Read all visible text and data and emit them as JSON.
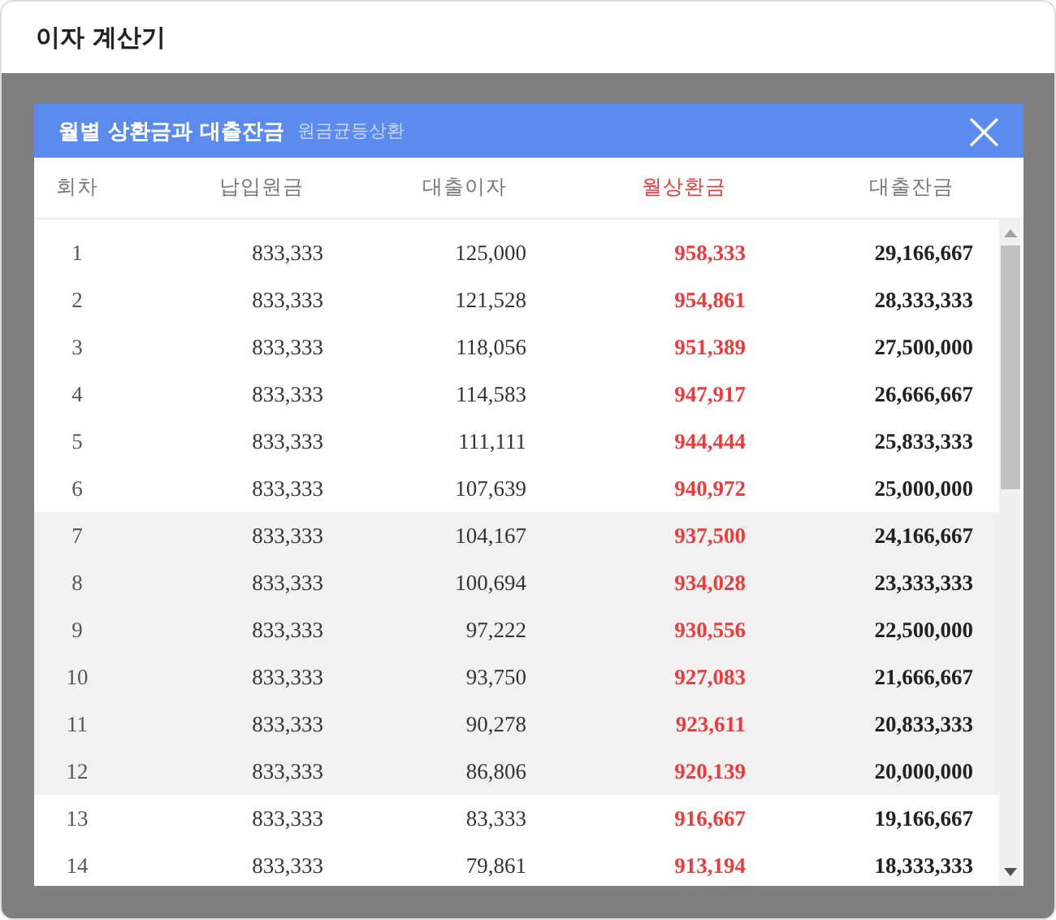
{
  "page_title": "이자 계산기",
  "modal": {
    "title": "월별 상환금과 대출잔금",
    "subtitle": "원금균등상환",
    "close": "×"
  },
  "table": {
    "columns": [
      "회차",
      "납입원금",
      "대출이자",
      "월상환금",
      "대출잔금"
    ],
    "rows": [
      {
        "cells": [
          "1",
          "833,333",
          "125,000",
          "958,333",
          "29,166,667"
        ],
        "shaded": false
      },
      {
        "cells": [
          "2",
          "833,333",
          "121,528",
          "954,861",
          "28,333,333"
        ],
        "shaded": false
      },
      {
        "cells": [
          "3",
          "833,333",
          "118,056",
          "951,389",
          "27,500,000"
        ],
        "shaded": false
      },
      {
        "cells": [
          "4",
          "833,333",
          "114,583",
          "947,917",
          "26,666,667"
        ],
        "shaded": false
      },
      {
        "cells": [
          "5",
          "833,333",
          "111,111",
          "944,444",
          "25,833,333"
        ],
        "shaded": false
      },
      {
        "cells": [
          "6",
          "833,333",
          "107,639",
          "940,972",
          "25,000,000"
        ],
        "shaded": false
      },
      {
        "cells": [
          "7",
          "833,333",
          "104,167",
          "937,500",
          "24,166,667"
        ],
        "shaded": true
      },
      {
        "cells": [
          "8",
          "833,333",
          "100,694",
          "934,028",
          "23,333,333"
        ],
        "shaded": true
      },
      {
        "cells": [
          "9",
          "833,333",
          "97,222",
          "930,556",
          "22,500,000"
        ],
        "shaded": true
      },
      {
        "cells": [
          "10",
          "833,333",
          "93,750",
          "927,083",
          "21,666,667"
        ],
        "shaded": true
      },
      {
        "cells": [
          "11",
          "833,333",
          "90,278",
          "923,611",
          "20,833,333"
        ],
        "shaded": true
      },
      {
        "cells": [
          "12",
          "833,333",
          "86,806",
          "920,139",
          "20,000,000"
        ],
        "shaded": true
      },
      {
        "cells": [
          "13",
          "833,333",
          "83,333",
          "916,667",
          "19,166,667"
        ],
        "shaded": false
      },
      {
        "cells": [
          "14",
          "833,333",
          "79,861",
          "913,194",
          "18,333,333"
        ],
        "shaded": false
      }
    ]
  }
}
